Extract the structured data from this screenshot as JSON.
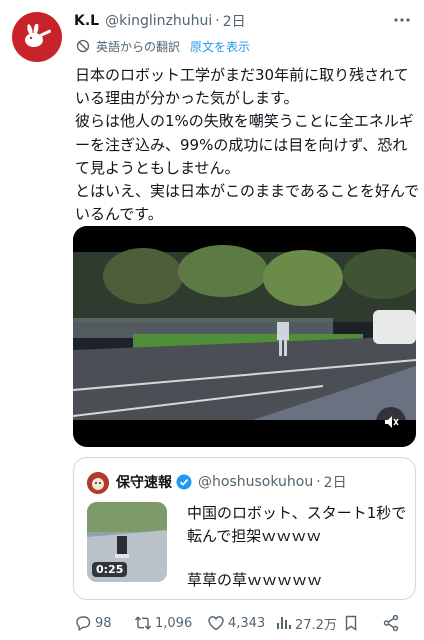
{
  "tweet": {
    "author_name": "K.L",
    "author_handle": "@kinglinzhuhui",
    "separator": "·",
    "time": "2日",
    "translation_label": "英語からの翻訳",
    "show_original_label": "原文を表示",
    "paragraphs": [
      "日本のロボット工学がまだ30年前に取り残されている理由が分かった気がします。",
      "彼らは他人の1%の失敗を嘲笑うことに全エネルギーを注ぎ込み、99%の成功には目を向けず、恐れて見ようともしません。",
      "とはいえ、実は日本がこのままであることを好んでいるんです。"
    ]
  },
  "quote": {
    "author_name": "保守速報",
    "author_handle": "@hoshusokuhou",
    "separator": "·",
    "time": "2日",
    "video_duration": "0:25",
    "lines": [
      "中国のロボット、スタート1秒で転んで担架ｗｗｗｗ",
      "草草の草ｗｗｗｗｗ"
    ]
  },
  "actions": {
    "replies": "98",
    "retweets": "1,096",
    "likes": "4,343",
    "views": "27.2万"
  },
  "colors": {
    "accent": "#1d9bf0",
    "secondary_text": "#536471",
    "avatar_bg": "#c8222a",
    "border": "#cfd9de"
  },
  "icons": [
    "avatar-rabbit",
    "more-icon",
    "globe-icon",
    "mute-icon",
    "verified-badge-icon",
    "reply-icon",
    "retweet-icon",
    "like-icon",
    "views-icon",
    "bookmark-icon",
    "share-icon"
  ]
}
